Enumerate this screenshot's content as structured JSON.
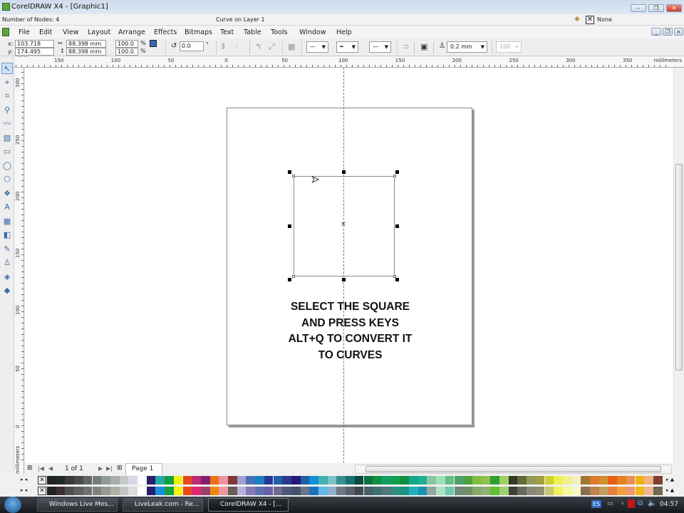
{
  "window": {
    "title": "CorelDRAW X4 - [Graphic1]"
  },
  "status": {
    "nodes": "Number of Nodes: 4",
    "object": "Curve on Layer 1",
    "fill_label": "None"
  },
  "menu": [
    "File",
    "Edit",
    "View",
    "Layout",
    "Arrange",
    "Effects",
    "Bitmaps",
    "Text",
    "Table",
    "Tools",
    "Window",
    "Help"
  ],
  "props": {
    "x_label": "x:",
    "x": "103.718 mm",
    "y_label": "y:",
    "y": "174.495 mm",
    "w": "88.398 mm",
    "h": "88.398 mm",
    "scale_x": "100.0",
    "scale_y": "100.0",
    "pct": "%",
    "rotation": "0.0",
    "deg": "°",
    "outline_width": "0.2 mm",
    "opacity": "100"
  },
  "ruler": {
    "unit": "millimeters",
    "h_ticks": [
      "150",
      "100",
      "50",
      "0",
      "50",
      "100",
      "150",
      "200",
      "250",
      "300",
      "350"
    ],
    "v_ticks": [
      "300",
      "250",
      "200",
      "150",
      "100",
      "50",
      "0"
    ]
  },
  "tools": [
    "pick-tool",
    "shape-tool",
    "crop-tool",
    "zoom-tool",
    "freehand-tool",
    "smart-fill-tool",
    "rectangle-tool",
    "ellipse-tool",
    "polygon-tool",
    "basic-shapes-tool",
    "text-tool",
    "table-tool",
    "interactive-blend-tool",
    "eyedropper-tool",
    "outline-tool",
    "fill-tool",
    "interactive-fill-tool"
  ],
  "canvas": {
    "instruction": [
      "SELECT THE SQUARE",
      "AND PRESS KEYS",
      "ALT+Q TO CONVERT IT",
      "TO CURVES"
    ]
  },
  "nav": {
    "page_count": "1 of 1",
    "page_tab": "Page 1"
  },
  "palette": {
    "row1": [
      "#222222",
      "#1e2a28",
      "#3a3a3a",
      "#4a4a4a",
      "#5e6862",
      "#7a7a7a",
      "#8f9a98",
      "#a8aeac",
      "#c4c8c8",
      "#d8d8e6",
      "#ffffff",
      "#2a1f6e",
      "#22aaaa",
      "#12a040",
      "#f0f010",
      "#e84818",
      "#c02a70",
      "#802070",
      "#f07010",
      "#f090a0",
      "#803838",
      "#a0a0d0",
      "#4a70b8",
      "#1a80c0",
      "#283890",
      "#2060a8",
      "#2a3a90",
      "#281a78",
      "#2060a0",
      "#1090d8",
      "#40b0b0",
      "#80c0c8",
      "#3a9090",
      "#1a7070",
      "#0a4a40",
      "#107040",
      "#109040",
      "#10a060",
      "#10a050",
      "#109040",
      "#10a890",
      "#20b090",
      "#88c8a0",
      "#a0e0b8",
      "#60c080",
      "#50a070",
      "#50a040",
      "#80c040",
      "#90c050",
      "#30a030",
      "#a0d060",
      "#303828",
      "#686838",
      "#909858",
      "#a0a040",
      "#d0d030",
      "#f0f050",
      "#f0f090",
      "#f0f0c0",
      "#a07830",
      "#e07830",
      "#d09030",
      "#e86010",
      "#e88020",
      "#e89050",
      "#f0b010",
      "#f0b080",
      "#804030"
    ],
    "row2": [
      "#222222",
      "#3a3030",
      "#505050",
      "#606060",
      "#707070",
      "#828282",
      "#969a92",
      "#b0b0a8",
      "#c4c4c4",
      "#dcdcdc",
      "#ffffff",
      "#2a1f6e",
      "#1890e0",
      "#12a040",
      "#f8f010",
      "#e84818",
      "#e02a70",
      "#a04070",
      "#f08810",
      "#f098a0",
      "#686058",
      "#b8b0d8",
      "#8878b8",
      "#6070b0",
      "#6a60a8",
      "#706890",
      "#505878",
      "#485070",
      "#687888",
      "#2070c0",
      "#60b8e8",
      "#90b0c8",
      "#707888",
      "#5a6070",
      "#404850",
      "#486068",
      "#407070",
      "#507878",
      "#309080",
      "#209080",
      "#20b0c0",
      "#2090b0",
      "#90a8a0",
      "#b0e0c8",
      "#70c8b0",
      "#708878",
      "#709068",
      "#88a868",
      "#90b078",
      "#60c030",
      "#a0d070",
      "#404038",
      "#686858",
      "#888878",
      "#909070",
      "#c8c870",
      "#f0f060",
      "#f8f8a0",
      "#f8f8c8",
      "#887050",
      "#c08050",
      "#c0a060",
      "#e88040",
      "#f0a040",
      "#f09870",
      "#f0b818",
      "#f0b890",
      "#706850"
    ]
  },
  "taskbar": {
    "items": [
      "Windows Live Mes...",
      "LiveLeak.com - Re...",
      "CorelDRAW X4 - [..."
    ],
    "lang": "ES",
    "clock": "04:57"
  }
}
